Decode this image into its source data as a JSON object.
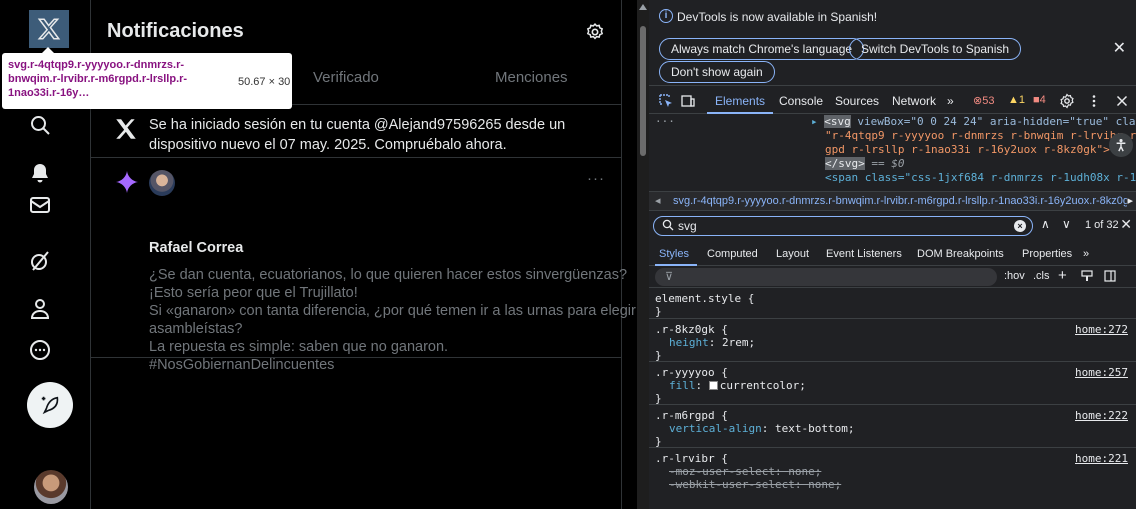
{
  "x": {
    "header_title": "Notificaciones",
    "tabs": {
      "verified": "Verificado",
      "mentions": "Menciones"
    },
    "tooltip": {
      "selector_lines": [
        "svg.r-4qtqp9.r-yyyyoo.r-dnmrzs.r-",
        "bnwqim.r-lrvibr.r-m6rgpd.r-lrsllp.r-",
        "1nao33i.r-16y…"
      ],
      "dimensions": "50.67 × 30"
    },
    "login_notification": "Se ha iniciado sesión en tu cuenta @Alejand97596265 desde un dispositivo nuevo el 07 may. 2025. Compruébalo ahora.",
    "post": {
      "more": "···",
      "author": "Rafael Correa",
      "lines": [
        "¿Se dan cuenta, ecuatorianos, lo que quieren hacer estos sinvergüenzas?",
        "¡Esto sería peor que el Trujillato!",
        "Si «ganaron» con tanta diferencia, ¿por qué temen ir a las urnas para elegir",
        "asambleístas?",
        "La repuesta es simple: saben que no ganaron.",
        "#NosGobiernanDelincuentes"
      ]
    },
    "icons": [
      "x-logo-icon",
      "search-icon",
      "bell-icon",
      "mail-icon",
      "grok-icon",
      "profile-icon",
      "more-circle-icon",
      "compose-icon"
    ]
  },
  "devtools": {
    "info": {
      "message": "DevTools is now available in Spanish!",
      "btn_match": "Always match Chrome's language",
      "btn_switch": "Switch DevTools to Spanish",
      "btn_dont": "Don't show again",
      "close": "✕"
    },
    "tabs": {
      "elements": "Elements",
      "console": "Console",
      "sources": "Sources",
      "network": "Network",
      "more": "»"
    },
    "badges": {
      "errors": "53",
      "warnings": "1",
      "info": "4"
    },
    "dom": {
      "ellipsis": "···",
      "line1_tag": "<svg",
      "line1_attrs": " viewBox=\"0 0 24 24\" aria-hidden=\"true\" class=",
      "line2": "\"r-4qtqp9 r-yyyyoo r-dnmrzs r-bnwqim r-lrvibr r-m6r",
      "line3": "gpd r-lrsllp r-1nao33i r-16y2uox r-8kz0gk\">",
      "line3_end": "···",
      "line4_close": "</svg>",
      "line4_eq": " == $0",
      "line5": "<span class=\"css-1jxf684 r-dnmrzs r-1udh08x r-1udbk0"
    },
    "breadcrumb": "svg.r-4qtqp9.r-yyyyoo.r-dnmrzs.r-bnwqim.r-lrvibr.r-m6rgpd.r-lrsllp.r-1nao33i.r-16y2uox.r-8kz0g",
    "search": {
      "value": "svg",
      "count": "1 of 32"
    },
    "styles_tabs": {
      "styles": "Styles",
      "computed": "Computed",
      "layout": "Layout",
      "events": "Event Listeners",
      "dom_bp": "DOM Breakpoints",
      "properties": "Properties",
      "more": "»"
    },
    "filter": {
      "hov": ":hov",
      "cls": ".cls",
      "plus": "+"
    },
    "rules": [
      {
        "selector": "element.style {",
        "props": [],
        "source": ""
      },
      {
        "selector": ".r-8kz0gk {",
        "props": [
          {
            "name": "height",
            "value": "2rem;"
          }
        ],
        "source": "home:272"
      },
      {
        "selector": ".r-yyyyoo {",
        "props": [
          {
            "name": "fill",
            "value": "currentcolor;"
          }
        ],
        "source": "home:257"
      },
      {
        "selector": ".r-m6rgpd {",
        "props": [
          {
            "name": "vertical-align",
            "value": "text-bottom;"
          }
        ],
        "source": "home:222"
      },
      {
        "selector": ".r-lrvibr {",
        "props": [
          {
            "name": "-moz-user-select",
            "value": "none;"
          },
          {
            "name": "-webkit-user-select",
            "value": "none;"
          }
        ],
        "source": "home:221"
      }
    ]
  }
}
